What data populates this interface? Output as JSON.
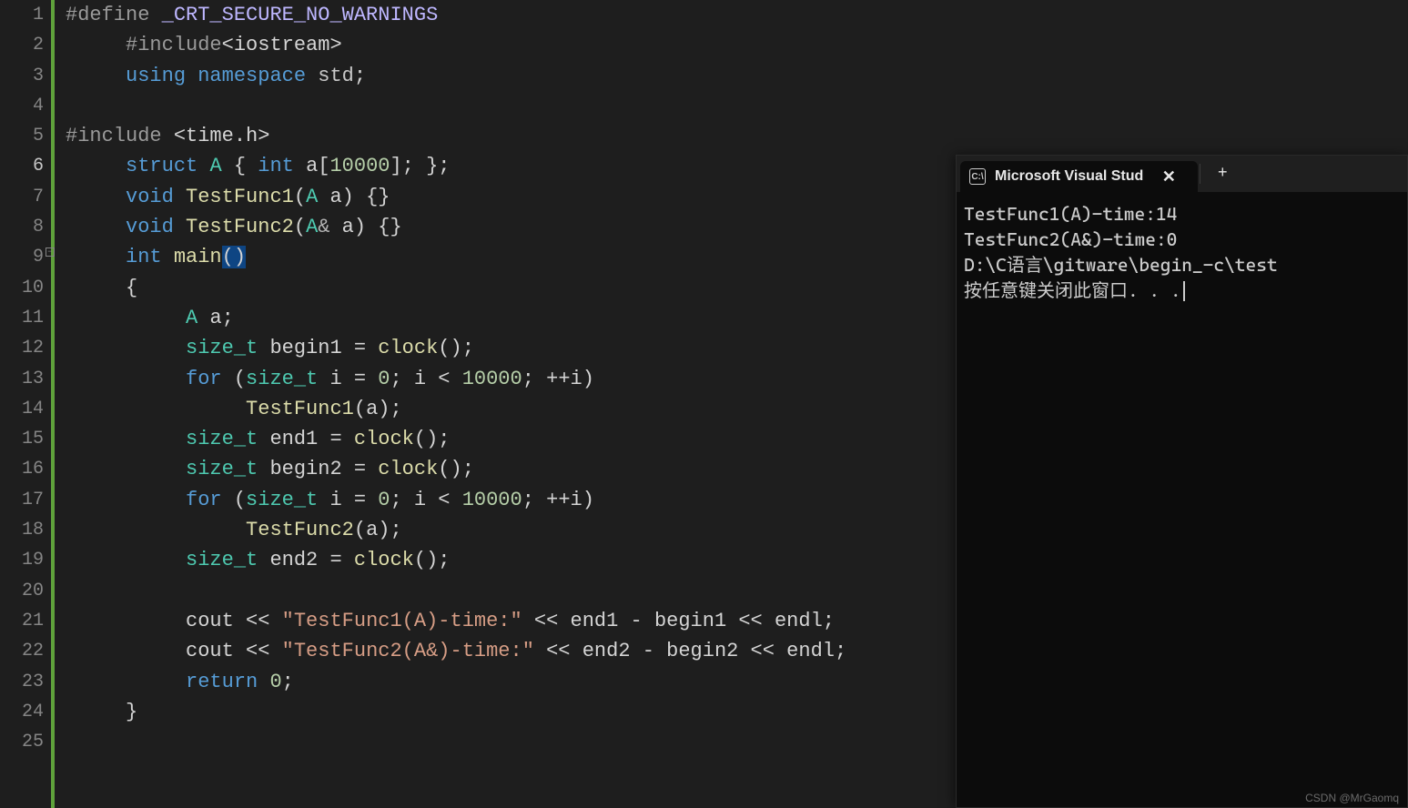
{
  "editor": {
    "line_count": 25,
    "active_line": 6,
    "code": [
      {
        "indent": 0,
        "tokens": [
          [
            "pp",
            "#define"
          ],
          [
            "punct",
            " "
          ],
          [
            "macro",
            "_CRT_SECURE_NO_WARNINGS"
          ]
        ]
      },
      {
        "indent": 1,
        "tokens": [
          [
            "pp",
            "#include"
          ],
          [
            "punct",
            "<"
          ],
          [
            "ident",
            "iostream"
          ],
          [
            "punct",
            ">"
          ]
        ]
      },
      {
        "indent": 1,
        "tokens": [
          [
            "kw",
            "using"
          ],
          [
            "punct",
            " "
          ],
          [
            "kw",
            "namespace"
          ],
          [
            "punct",
            " "
          ],
          [
            "namespace",
            "std"
          ],
          [
            "punct",
            ";"
          ]
        ]
      },
      {
        "indent": 0,
        "tokens": []
      },
      {
        "indent": 0,
        "tokens": [
          [
            "pp",
            "#include"
          ],
          [
            "punct",
            " <"
          ],
          [
            "ident",
            "time.h"
          ],
          [
            "punct",
            ">"
          ]
        ]
      },
      {
        "indent": 1,
        "tokens": [
          [
            "kw",
            "struct"
          ],
          [
            "punct",
            " "
          ],
          [
            "type",
            "A"
          ],
          [
            "punct",
            " { "
          ],
          [
            "kw",
            "int"
          ],
          [
            "punct",
            " "
          ],
          [
            "ident",
            "a"
          ],
          [
            "punct",
            "["
          ],
          [
            "num",
            "10000"
          ],
          [
            "punct",
            "]; };"
          ]
        ]
      },
      {
        "indent": 1,
        "tokens": [
          [
            "kw",
            "void"
          ],
          [
            "punct",
            " "
          ],
          [
            "func",
            "TestFunc1"
          ],
          [
            "punct",
            "("
          ],
          [
            "type",
            "A"
          ],
          [
            "punct",
            " "
          ],
          [
            "ident",
            "a"
          ],
          [
            "punct",
            ") {}"
          ]
        ]
      },
      {
        "indent": 1,
        "tokens": [
          [
            "kw",
            "void"
          ],
          [
            "punct",
            " "
          ],
          [
            "func",
            "TestFunc2"
          ],
          [
            "punct",
            "("
          ],
          [
            "type",
            "A"
          ],
          [
            "op",
            "&"
          ],
          [
            "punct",
            " "
          ],
          [
            "ident",
            "a"
          ],
          [
            "punct",
            ") {}"
          ]
        ]
      },
      {
        "indent": 1,
        "tokens": [
          [
            "kw",
            "int"
          ],
          [
            "punct",
            " "
          ],
          [
            "func",
            "main"
          ],
          [
            "paren-hl",
            "("
          ],
          [
            "paren-hl",
            ")"
          ]
        ]
      },
      {
        "indent": 1,
        "tokens": [
          [
            "punct",
            "{"
          ]
        ]
      },
      {
        "indent": 2,
        "tokens": [
          [
            "type",
            "A"
          ],
          [
            "punct",
            " "
          ],
          [
            "ident",
            "a"
          ],
          [
            "punct",
            ";"
          ]
        ]
      },
      {
        "indent": 2,
        "tokens": [
          [
            "type",
            "size_t"
          ],
          [
            "punct",
            " "
          ],
          [
            "ident",
            "begin1"
          ],
          [
            "punct",
            " = "
          ],
          [
            "func",
            "clock"
          ],
          [
            "punct",
            "();"
          ]
        ]
      },
      {
        "indent": 2,
        "tokens": [
          [
            "kw",
            "for"
          ],
          [
            "punct",
            " ("
          ],
          [
            "type",
            "size_t"
          ],
          [
            "punct",
            " "
          ],
          [
            "ident",
            "i"
          ],
          [
            "punct",
            " = "
          ],
          [
            "num",
            "0"
          ],
          [
            "punct",
            "; "
          ],
          [
            "ident",
            "i"
          ],
          [
            "punct",
            " < "
          ],
          [
            "num",
            "10000"
          ],
          [
            "punct",
            "; ++"
          ],
          [
            "ident",
            "i"
          ],
          [
            "punct",
            ")"
          ]
        ]
      },
      {
        "indent": 3,
        "tokens": [
          [
            "func",
            "TestFunc1"
          ],
          [
            "punct",
            "("
          ],
          [
            "ident",
            "a"
          ],
          [
            "punct",
            ");"
          ]
        ]
      },
      {
        "indent": 2,
        "tokens": [
          [
            "type",
            "size_t"
          ],
          [
            "punct",
            " "
          ],
          [
            "ident",
            "end1"
          ],
          [
            "punct",
            " = "
          ],
          [
            "func",
            "clock"
          ],
          [
            "punct",
            "();"
          ]
        ]
      },
      {
        "indent": 2,
        "tokens": [
          [
            "type",
            "size_t"
          ],
          [
            "punct",
            " "
          ],
          [
            "ident",
            "begin2"
          ],
          [
            "punct",
            " = "
          ],
          [
            "func",
            "clock"
          ],
          [
            "punct",
            "();"
          ]
        ]
      },
      {
        "indent": 2,
        "tokens": [
          [
            "kw",
            "for"
          ],
          [
            "punct",
            " ("
          ],
          [
            "type",
            "size_t"
          ],
          [
            "punct",
            " "
          ],
          [
            "ident",
            "i"
          ],
          [
            "punct",
            " = "
          ],
          [
            "num",
            "0"
          ],
          [
            "punct",
            "; "
          ],
          [
            "ident",
            "i"
          ],
          [
            "punct",
            " < "
          ],
          [
            "num",
            "10000"
          ],
          [
            "punct",
            "; ++"
          ],
          [
            "ident",
            "i"
          ],
          [
            "punct",
            ")"
          ]
        ]
      },
      {
        "indent": 3,
        "tokens": [
          [
            "func",
            "TestFunc2"
          ],
          [
            "punct",
            "("
          ],
          [
            "ident",
            "a"
          ],
          [
            "punct",
            ");"
          ]
        ]
      },
      {
        "indent": 2,
        "tokens": [
          [
            "type",
            "size_t"
          ],
          [
            "punct",
            " "
          ],
          [
            "ident",
            "end2"
          ],
          [
            "punct",
            " = "
          ],
          [
            "func",
            "clock"
          ],
          [
            "punct",
            "();"
          ]
        ]
      },
      {
        "indent": 0,
        "tokens": []
      },
      {
        "indent": 2,
        "tokens": [
          [
            "ident",
            "cout"
          ],
          [
            "punct",
            " << "
          ],
          [
            "str",
            "\"TestFunc1(A)-time:\""
          ],
          [
            "punct",
            " << "
          ],
          [
            "ident",
            "end1"
          ],
          [
            "punct",
            " - "
          ],
          [
            "ident",
            "begin1"
          ],
          [
            "punct",
            " << "
          ],
          [
            "ident",
            "endl"
          ],
          [
            "punct",
            ";"
          ]
        ]
      },
      {
        "indent": 2,
        "tokens": [
          [
            "ident",
            "cout"
          ],
          [
            "punct",
            " << "
          ],
          [
            "str",
            "\"TestFunc2(A&)-time:\""
          ],
          [
            "punct",
            " << "
          ],
          [
            "ident",
            "end2"
          ],
          [
            "punct",
            " - "
          ],
          [
            "ident",
            "begin2"
          ],
          [
            "punct",
            " << "
          ],
          [
            "ident",
            "endl"
          ],
          [
            "punct",
            ";"
          ]
        ]
      },
      {
        "indent": 2,
        "tokens": [
          [
            "kw",
            "return"
          ],
          [
            "punct",
            " "
          ],
          [
            "num",
            "0"
          ],
          [
            "punct",
            ";"
          ]
        ]
      },
      {
        "indent": 1,
        "tokens": [
          [
            "punct",
            "}"
          ]
        ]
      },
      {
        "indent": 0,
        "tokens": []
      }
    ]
  },
  "terminal": {
    "tab_title": "Microsoft Visual Stud",
    "output_lines": [
      "TestFunc1(A)-time:14",
      "TestFunc2(A&)-time:0",
      "",
      "D:\\C语言\\gitware\\begin_-c\\test",
      "按任意键关闭此窗口. . ."
    ]
  },
  "watermark": "CSDN @MrGaomq"
}
